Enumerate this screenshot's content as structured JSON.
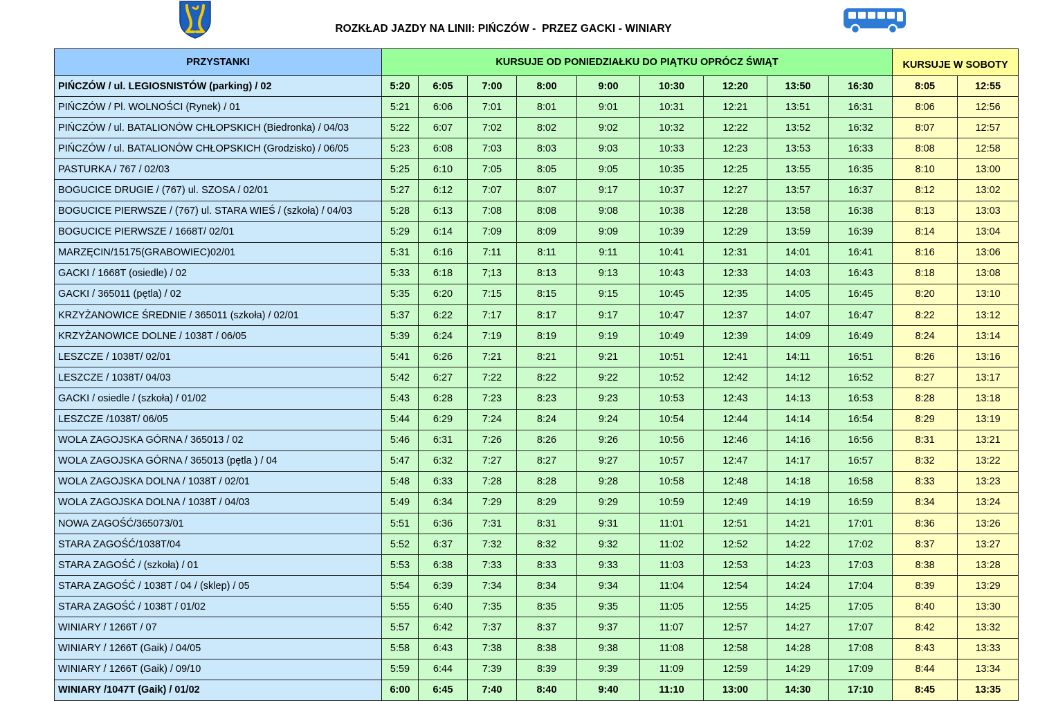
{
  "header": {
    "title": "ROZKŁAD JAZDY NA LINII: PIŃCZÓW -  PRZEZ GACKI - WINIARY",
    "crest_icon": "crest-icon",
    "bus_icon": "bus-icon",
    "colors": {
      "stops": "#cce8fb",
      "weekday": "#ccfccc",
      "saturday": "#ffffc4",
      "stops_header": "#99ccff",
      "weekday_header": "#99ff99",
      "saturday_header": "#ffff99",
      "bus": "#2e7bd6"
    }
  },
  "table": {
    "headers": {
      "stops": "PRZYSTANKI",
      "weekday": "KURSUJE OD PONIEDZIAŁKU DO PIĄTKU OPRÓCZ ŚWIĄT",
      "saturday": "KURSUJE W SOBOTY"
    },
    "rows": [
      {
        "stop": "PIŃCZÓW / ul. LEGIOSNISTÓW  (parking) / 02",
        "wk": [
          "5:20",
          "6:05",
          "7:00",
          "8:00",
          "9:00",
          "10:30",
          "12:20",
          "13:50",
          "16:30"
        ],
        "sat": [
          "8:05",
          "12:55"
        ],
        "bold": true
      },
      {
        "stop": "PIŃCZÓW / Pl. WOLNOŚCI (Rynek) / 01",
        "wk": [
          "5:21",
          "6:06",
          "7:01",
          "8:01",
          "9:01",
          "10:31",
          "12:21",
          "13:51",
          "16:31"
        ],
        "sat": [
          "8:06",
          "12:56"
        ]
      },
      {
        "stop": "PIŃCZÓW / ul. BATALIONÓW CHŁOPSKICH (Biedronka) / 04/03",
        "wk": [
          "5:22",
          "6:07",
          "7:02",
          "8:02",
          "9:02",
          "10:32",
          "12:22",
          "13:52",
          "16:32"
        ],
        "sat": [
          "8:07",
          "12:57"
        ]
      },
      {
        "stop": "PIŃCZÓW / ul. BATALIONÓW CHŁOPSKICH (Grodzisko) / 06/05",
        "wk": [
          "5:23",
          "6:08",
          "7:03",
          "8:03",
          "9:03",
          "10:33",
          "12:23",
          "13:53",
          "16:33"
        ],
        "sat": [
          "8:08",
          "12:58"
        ]
      },
      {
        "stop": "PASTURKA / 767 / 02/03",
        "wk": [
          "5:25",
          "6:10",
          "7:05",
          "8:05",
          "9:05",
          "10:35",
          "12:25",
          "13:55",
          "16:35"
        ],
        "sat": [
          "8:10",
          "13:00"
        ]
      },
      {
        "stop": "BOGUCICE DRUGIE / (767) ul. SZOSA / 02/01",
        "wk": [
          "5:27",
          "6:12",
          "7:07",
          "8:07",
          "9:17",
          "10:37",
          "12:27",
          "13:57",
          "16:37"
        ],
        "sat": [
          "8:12",
          "13:02"
        ]
      },
      {
        "stop": "BOGUCICE PIERWSZE / (767) ul. STARA WIEŚ / (szkoła) / 04/03",
        "wk": [
          "5:28",
          "6:13",
          "7:08",
          "8:08",
          "9:08",
          "10:38",
          "12:28",
          "13:58",
          "16:38"
        ],
        "sat": [
          "8:13",
          "13:03"
        ]
      },
      {
        "stop": "BOGUCICE PIERWSZE / 1668T/ 02/01",
        "wk": [
          "5:29",
          "6:14",
          "7:09",
          "8:09",
          "9:09",
          "10:39",
          "12:29",
          "13:59",
          "16:39"
        ],
        "sat": [
          "8:14",
          "13:04"
        ]
      },
      {
        "stop": "MARZĘCIN/15175(GRABOWIEC)02/01",
        "wk": [
          "5:31",
          "6:16",
          "7:11",
          "8:11",
          "9:11",
          "10:41",
          "12:31",
          "14:01",
          "16:41"
        ],
        "sat": [
          "8:16",
          "13:06"
        ]
      },
      {
        "stop": "GACKI / 1668T (osiedle) / 02",
        "wk": [
          "5:33",
          "6:18",
          "7;13",
          "8:13",
          "9:13",
          "10:43",
          "12:33",
          "14:03",
          "16:43"
        ],
        "sat": [
          "8:18",
          "13:08"
        ]
      },
      {
        "stop": "GACKI / 365011 (pętla) / 02",
        "wk": [
          "5:35",
          "6:20",
          "7:15",
          "8:15",
          "9:15",
          "10:45",
          "12:35",
          "14:05",
          "16:45"
        ],
        "sat": [
          "8:20",
          "13:10"
        ]
      },
      {
        "stop": "KRZYŻANOWICE ŚREDNIE / 365011 (szkoła) / 02/01",
        "wk": [
          "5:37",
          "6:22",
          "7:17",
          "8:17",
          "9:17",
          "10:47",
          "12:37",
          "14:07",
          "16:47"
        ],
        "sat": [
          "8:22",
          "13:12"
        ]
      },
      {
        "stop": "KRZYŻANOWICE DOLNE / 1038T / 06/05",
        "wk": [
          "5:39",
          "6:24",
          "7:19",
          "8:19",
          "9:19",
          "10:49",
          "12:39",
          "14:09",
          "16:49"
        ],
        "sat": [
          "8:24",
          "13:14"
        ]
      },
      {
        "stop": "LESZCZE / 1038T/ 02/01",
        "wk": [
          "5:41",
          "6:26",
          "7:21",
          "8:21",
          "9:21",
          "10:51",
          "12:41",
          "14:11",
          "16:51"
        ],
        "sat": [
          "8:26",
          "13:16"
        ]
      },
      {
        "stop": "LESZCZE / 1038T/ 04/03",
        "wk": [
          "5:42",
          "6:27",
          "7:22",
          "8:22",
          "9:22",
          "10:52",
          "12:42",
          "14:12",
          "16:52"
        ],
        "sat": [
          "8:27",
          "13:17"
        ]
      },
      {
        "stop": "GACKI / osiedle / (szkoła) / 01/02",
        "wk": [
          "5:43",
          "6:28",
          "7:23",
          "8:23",
          "9:23",
          "10:53",
          "12:43",
          "14:13",
          "16:53"
        ],
        "sat": [
          "8:28",
          "13:18"
        ]
      },
      {
        "stop": "LESZCZE /1038T/ 06/05",
        "wk": [
          "5:44",
          "6:29",
          "7:24",
          "8:24",
          "9:24",
          "10:54",
          "12:44",
          "14:14",
          "16:54"
        ],
        "sat": [
          "8:29",
          "13:19"
        ]
      },
      {
        "stop": "WOLA ZAGOJSKA GÓRNA / 365013 / 02",
        "wk": [
          "5:46",
          "6:31",
          "7:26",
          "8:26",
          "9:26",
          "10:56",
          "12:46",
          "14:16",
          "16:56"
        ],
        "sat": [
          "8:31",
          "13:21"
        ]
      },
      {
        "stop": "WOLA ZAGOJSKA GÓRNA / 365013 (pętla ) / 04",
        "wk": [
          "5:47",
          "6:32",
          "7:27",
          "8:27",
          "9:27",
          "10:57",
          "12:47",
          "14:17",
          "16:57"
        ],
        "sat": [
          "8:32",
          "13:22"
        ]
      },
      {
        "stop": "WOLA ZAGOJSKA DOLNA / 1038T / 02/01",
        "wk": [
          "5:48",
          "6:33",
          "7:28",
          "8:28",
          "9:28",
          "10:58",
          "12:48",
          "14:18",
          "16:58"
        ],
        "sat": [
          "8:33",
          "13:23"
        ]
      },
      {
        "stop": "WOLA ZAGOJSKA DOLNA / 1038T / 04/03",
        "wk": [
          "5:49",
          "6:34",
          "7:29",
          "8:29",
          "9:29",
          "10:59",
          "12:49",
          "14:19",
          "16:59"
        ],
        "sat": [
          "8:34",
          "13:24"
        ]
      },
      {
        "stop": "NOWA ZAGOŚĆ/365073/01",
        "wk": [
          "5:51",
          "6:36",
          "7:31",
          "8:31",
          "9:31",
          "11:01",
          "12:51",
          "14:21",
          "17:01"
        ],
        "sat": [
          "8:36",
          "13:26"
        ]
      },
      {
        "stop": "STARA ZAGOŚĆ/1038T/04",
        "wk": [
          "5:52",
          "6:37",
          "7:32",
          "8:32",
          "9:32",
          "11:02",
          "12:52",
          "14:22",
          "17:02"
        ],
        "sat": [
          "8:37",
          "13:27"
        ]
      },
      {
        "stop": "STARA ZAGOŚĆ / (szkoła) / 01",
        "wk": [
          "5:53",
          "6:38",
          "7:33",
          "8:33",
          "9:33",
          "11:03",
          "12:53",
          "14:23",
          "17:03"
        ],
        "sat": [
          "8:38",
          "13:28"
        ]
      },
      {
        "stop": "STARA ZAGOŚĆ / 1038T / 04 / (sklep) / 05",
        "wk": [
          "5:54",
          "6:39",
          "7:34",
          "8:34",
          "9:34",
          "11:04",
          "12:54",
          "14:24",
          "17:04"
        ],
        "sat": [
          "8:39",
          "13:29"
        ]
      },
      {
        "stop": "STARA ZAGOŚĆ / 1038T / 01/02",
        "wk": [
          "5:55",
          "6:40",
          "7:35",
          "8:35",
          "9:35",
          "11:05",
          "12:55",
          "14:25",
          "17:05"
        ],
        "sat": [
          "8:40",
          "13:30"
        ]
      },
      {
        "stop": "WINIARY / 1266T / 07",
        "wk": [
          "5:57",
          "6:42",
          "7:37",
          "8:37",
          "9:37",
          "11:07",
          "12:57",
          "14:27",
          "17:07"
        ],
        "sat": [
          "8:42",
          "13:32"
        ]
      },
      {
        "stop": "WINIARY / 1266T (Gaik) / 04/05",
        "wk": [
          "5:58",
          "6:43",
          "7:38",
          "8:38",
          "9:38",
          "11:08",
          "12:58",
          "14:28",
          "17:08"
        ],
        "sat": [
          "8:43",
          "13:33"
        ]
      },
      {
        "stop": "WINIARY / 1266T (Gaik) / 09/10",
        "wk": [
          "5:59",
          "6:44",
          "7:39",
          "8:39",
          "9:39",
          "11:09",
          "12:59",
          "14:29",
          "17:09"
        ],
        "sat": [
          "8:44",
          "13:34"
        ]
      },
      {
        "stop": "WINIARY /1047T (Gaik) / 01/02",
        "wk": [
          "6:00",
          "6:45",
          "7:40",
          "8:40",
          "9:40",
          "11:10",
          "13:00",
          "14:30",
          "17:10"
        ],
        "sat": [
          "8:45",
          "13:35"
        ],
        "bold": true
      }
    ]
  }
}
